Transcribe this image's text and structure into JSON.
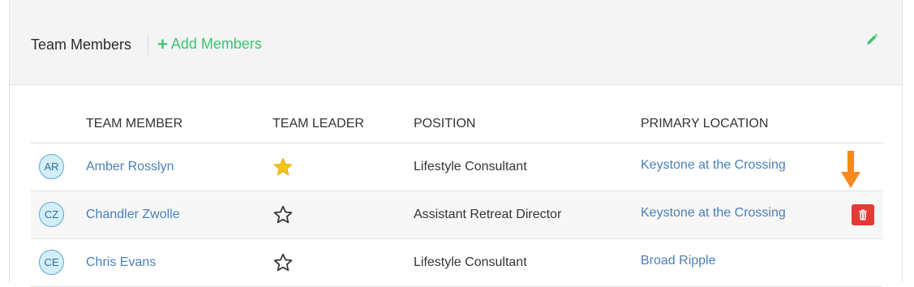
{
  "header": {
    "title": "Team Members",
    "add_label": "Add Members",
    "plus_glyph": "+",
    "edit_icon": "pencil-icon"
  },
  "table": {
    "columns": [
      "TEAM MEMBER",
      "TEAM LEADER",
      "POSITION",
      "PRIMARY LOCATION"
    ],
    "rows": [
      {
        "initials": "AR",
        "name": "Amber Rosslyn",
        "leader": true,
        "position": "Lifestyle Consultant",
        "location": "Keystone at the Crossing"
      },
      {
        "initials": "CZ",
        "name": "Chandler Zwolle",
        "leader": false,
        "position": "Assistant Retreat Director",
        "location": "Keystone at the Crossing"
      },
      {
        "initials": "CE",
        "name": "Chris Evans",
        "leader": false,
        "position": "Lifestyle Consultant",
        "location": "Broad Ripple"
      }
    ]
  },
  "colors": {
    "accent_green": "#3ec46d",
    "link_blue": "#4a7fb8",
    "star_gold": "#f5c518",
    "delete_red": "#e53935",
    "annotation_orange": "#f5891f"
  },
  "icons": [
    "pencil-icon",
    "star-filled-icon",
    "star-outline-icon",
    "trash-icon",
    "arrow-down-icon"
  ]
}
